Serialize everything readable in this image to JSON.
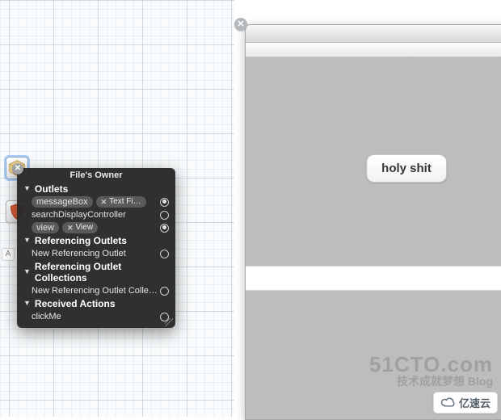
{
  "hud": {
    "title": "File's Owner",
    "sections": {
      "outlets": {
        "label": "Outlets",
        "rows": [
          {
            "name": "messageBox",
            "connected_to": "Text Fi…",
            "filled": true,
            "pill": true
          },
          {
            "name": "searchDisplayController",
            "connected_to": "",
            "filled": false,
            "pill": false
          },
          {
            "name": "view",
            "connected_to": "View",
            "filled": true,
            "pill": true
          }
        ]
      },
      "ref_outlets": {
        "label": "Referencing Outlets",
        "rows": [
          {
            "name": "New Referencing Outlet",
            "filled": false
          }
        ]
      },
      "ref_outlet_coll": {
        "label": "Referencing Outlet Collections",
        "rows": [
          {
            "name": "New Referencing Outlet Colle…",
            "filled": false
          }
        ]
      },
      "recv_actions": {
        "label": "Received Actions",
        "rows": [
          {
            "name": "clickMe",
            "filled": false
          }
        ]
      }
    }
  },
  "simulator": {
    "button_label": "holy shit"
  },
  "chip_char": "A",
  "watermark": {
    "line1": "51CTO.com",
    "line2": "技术成就梦想   Blog",
    "badge": "亿速云"
  }
}
